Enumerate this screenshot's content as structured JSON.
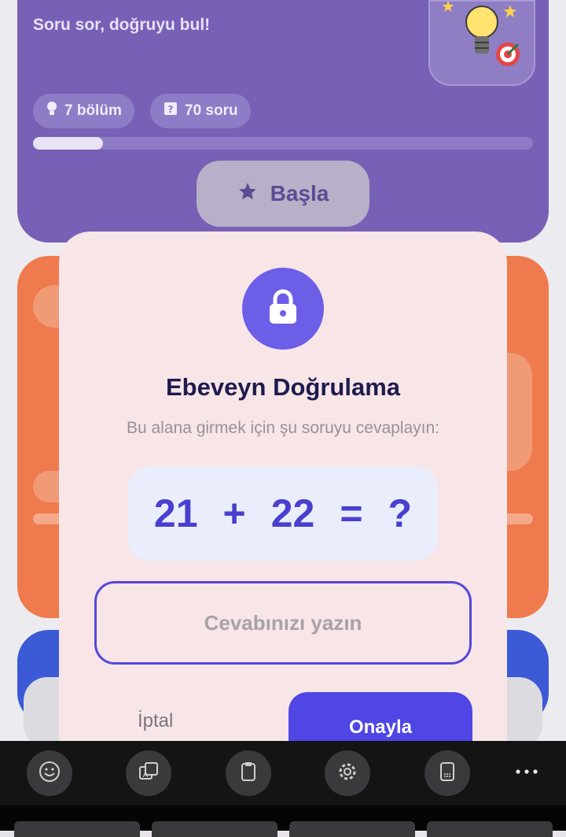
{
  "quiz_card": {
    "subtitle": "Soru sor, doğruyu bul!",
    "chip_sections": "7 bölüm",
    "chip_questions": "70 soru",
    "progress_fraction": 0.14,
    "start_label": "Başla"
  },
  "dialog": {
    "title": "Ebeveyn Doğrulama",
    "description": "Bu alana girmek için şu soruyu cevaplayın:",
    "question": {
      "a": "21",
      "op": "+",
      "b": "22",
      "eq": "=",
      "unknown": "?"
    },
    "answer_placeholder": "Cevabınızı yazın",
    "answer_value": "",
    "cancel_label": "İptal",
    "confirm_label": "Onayla"
  },
  "keyboard_toolbar": {
    "items": [
      "emoji-icon",
      "translate-icon",
      "clipboard-icon",
      "settings-icon",
      "keyboard-layout-icon",
      "more-icon"
    ]
  },
  "colors": {
    "accent": "#4f46e5",
    "lock_circle": "#6d5ee8",
    "question_text": "#4a3fcf",
    "dialog_bg": "#f7e5e8"
  }
}
